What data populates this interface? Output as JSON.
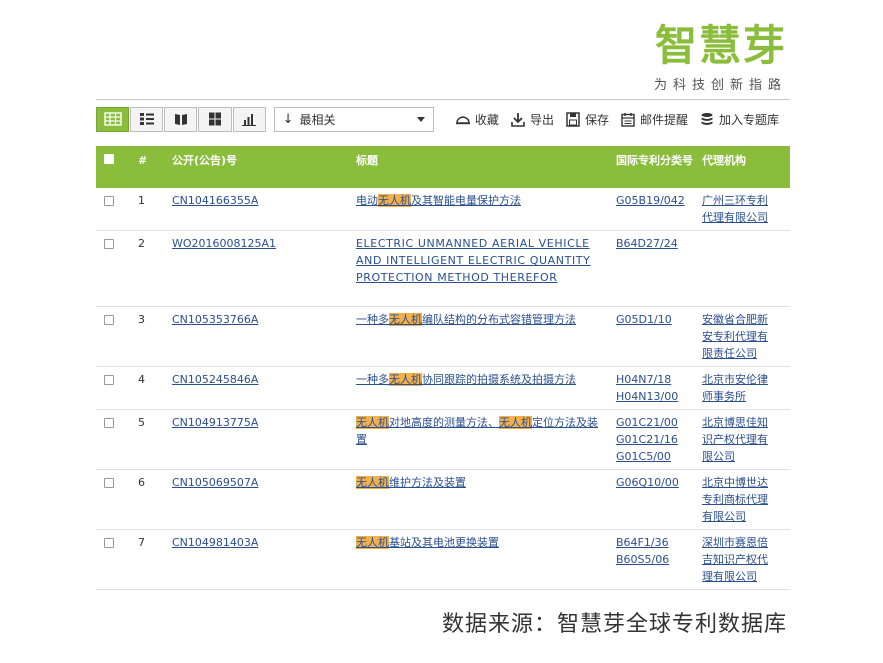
{
  "brand": {
    "name": "智慧芽",
    "slogan": "为科技创新指路",
    "color": "#8bbd3c"
  },
  "toolbar": {
    "views": [
      {
        "icon": "table-view-icon",
        "active": true
      },
      {
        "icon": "list-view-icon",
        "active": false
      },
      {
        "icon": "book-view-icon",
        "active": false
      },
      {
        "icon": "grid-view-icon",
        "active": false
      },
      {
        "icon": "chart-view-icon",
        "active": false
      }
    ],
    "sort": {
      "label": "最相关",
      "icon": "sort-down-arrow-icon"
    },
    "actions": [
      {
        "label": "收藏",
        "icon": "cloud-icon"
      },
      {
        "label": "导出",
        "icon": "download-icon"
      },
      {
        "label": "保存",
        "icon": "floppy-disk-icon"
      },
      {
        "label": "邮件提醒",
        "icon": "calendar-icon"
      },
      {
        "label": "加入专题库",
        "icon": "database-icon"
      }
    ]
  },
  "table": {
    "columns": [
      "#",
      "公开(公告)号",
      "标题",
      "国际专利分类号",
      "代理机构"
    ],
    "rows": [
      {
        "num": "1",
        "pub": "CN104166355A",
        "title": [
          {
            "t": "电动"
          },
          {
            "t": "无人机",
            "hl": true
          },
          {
            "t": "及其智能电量保护方法"
          }
        ],
        "ipc": [
          "G05B19/042"
        ],
        "agency": [
          "广州三环专利",
          "代理有限公司"
        ]
      },
      {
        "num": "2",
        "pub": "WO2016008125A1",
        "title": [
          {
            "t": "ELECTRIC UNMANNED AERIAL VEHICLE AND INTELLIGENT ELECTRIC QUANTITY PROTECTION METHOD THEREFOR"
          }
        ],
        "en": true,
        "ipc": [
          "B64D27/24"
        ],
        "agency": []
      },
      {
        "num": "3",
        "pub": "CN105353766A",
        "title": [
          {
            "t": "一种多"
          },
          {
            "t": "无人机",
            "hl": true
          },
          {
            "t": "编队结构的分布式容错管理方法"
          }
        ],
        "ipc": [
          "G05D1/10"
        ],
        "agency": [
          "安徽省合肥新",
          "安专利代理有",
          "限责任公司"
        ]
      },
      {
        "num": "4",
        "pub": "CN105245846A",
        "title": [
          {
            "t": "一种多"
          },
          {
            "t": "无人机",
            "hl": true
          },
          {
            "t": "协同跟踪的拍摄系统及拍摄方法"
          }
        ],
        "ipc": [
          "H04N7/18",
          "H04N13/00"
        ],
        "agency": [
          "北京市安伦律",
          "师事务所"
        ]
      },
      {
        "num": "5",
        "pub": "CN104913775A",
        "title": [
          {
            "t": "无人机",
            "hl": true
          },
          {
            "t": "对地高度的测量方法、"
          },
          {
            "t": "无人机",
            "hl": true
          },
          {
            "t": "定位方法及装置"
          }
        ],
        "ipc": [
          "G01C21/00",
          "G01C21/16",
          "G01C5/00"
        ],
        "agency": [
          "北京博思佳知",
          "识产权代理有",
          "限公司"
        ]
      },
      {
        "num": "6",
        "pub": "CN105069507A",
        "title": [
          {
            "t": "无人机",
            "hl": true
          },
          {
            "t": "维护方法及装置"
          }
        ],
        "ipc": [
          "G06Q10/00"
        ],
        "agency": [
          "北京中博世达",
          "专利商标代理",
          "有限公司"
        ]
      },
      {
        "num": "7",
        "pub": "CN104981403A",
        "title": [
          {
            "t": "无人机",
            "hl": true
          },
          {
            "t": "基站及其电池更换装置"
          }
        ],
        "ipc": [
          "B64F1/36",
          "B60S5/06"
        ],
        "agency": [
          "深圳市赛恩倍",
          "吉知识产权代",
          "理有限公司"
        ]
      }
    ]
  },
  "footer": {
    "source": "数据来源：智慧芽全球专利数据库"
  }
}
